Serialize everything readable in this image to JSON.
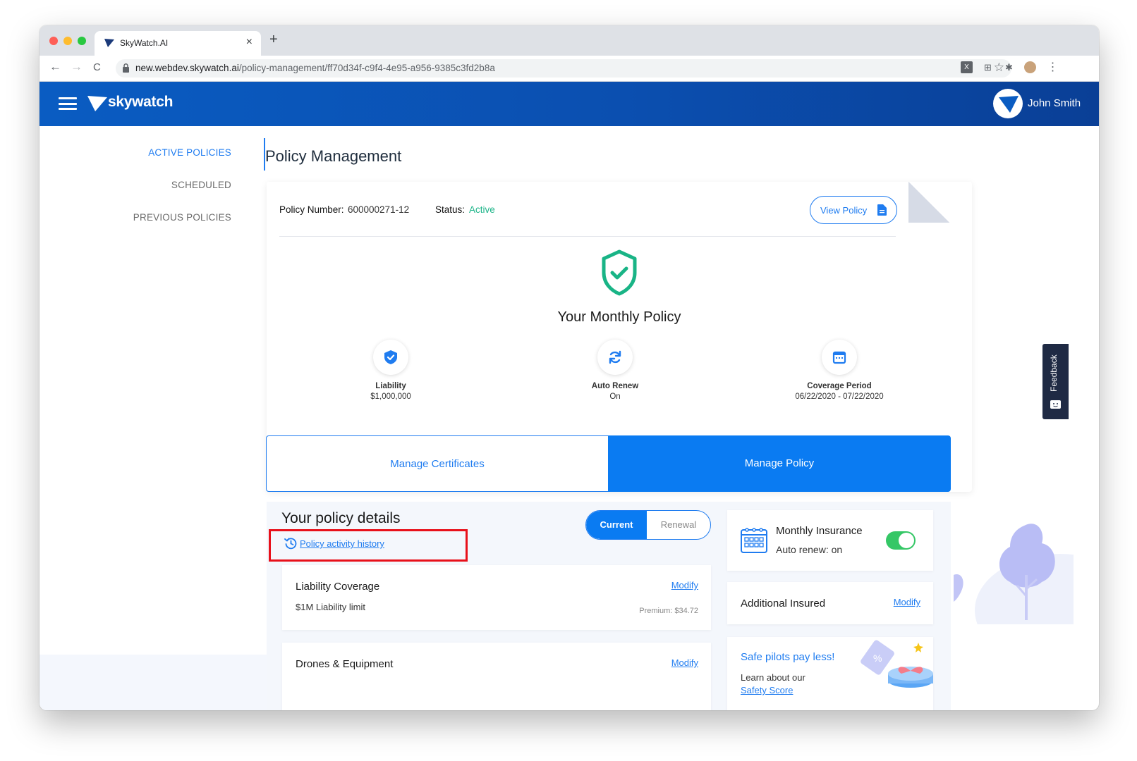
{
  "browser": {
    "tab_title": "SkyWatch.AI",
    "tab_close": "×",
    "new_tab": "+",
    "url_host": "new.webdev.skywatch.ai",
    "url_path": "/policy-management/ff70d34f-c9f4-4e95-a956-9385c3fd2b8a",
    "back": "←",
    "forward": "→",
    "reload": "C",
    "star": "☆",
    "menu": "⋮"
  },
  "app": {
    "logo": "skywatch",
    "user_name": "John Smith",
    "brand_color": "#0a5cc2",
    "accent_color": "#1f7cf0"
  },
  "sidebar": {
    "items": [
      {
        "label": "ACTIVE POLICIES",
        "active": true
      },
      {
        "label": "SCHEDULED",
        "active": false
      },
      {
        "label": "PREVIOUS POLICIES",
        "active": false
      }
    ]
  },
  "main": {
    "title": "Policy Management",
    "policy_number_label": "Policy Number:",
    "policy_number": "600000271-12",
    "status_label": "Status:",
    "status": "Active",
    "view_policy": "View Policy",
    "plan_title": "Your Monthly Policy",
    "features": [
      {
        "icon": "shield-check-icon",
        "label": "Liability",
        "value": "$1,000,000"
      },
      {
        "icon": "refresh-icon",
        "label": "Auto Renew",
        "value": "On"
      },
      {
        "icon": "calendar-icon",
        "label": "Coverage Period",
        "value": "06/22/2020 - 07/22/2020"
      }
    ],
    "manage_certificates": "Manage Certificates",
    "manage_policy": "Manage Policy"
  },
  "details": {
    "title": "Your policy details",
    "history_link": "Policy activity history",
    "toggle": {
      "current": "Current",
      "renewal": "Renewal",
      "selected": "Current"
    },
    "coverages": [
      {
        "title": "Liability Coverage",
        "subtitle": "$1M Liability limit",
        "modify": "Modify",
        "premium": "Premium: $34.72"
      },
      {
        "title": "Drones & Equipment",
        "subtitle": "",
        "modify": "Modify",
        "premium": ""
      }
    ],
    "monthly_insurance": {
      "title": "Monthly Insurance",
      "subtitle": "Auto renew: on",
      "toggle_on": true
    },
    "additional_insured": {
      "title": "Additional Insured",
      "modify": "Modify"
    },
    "promo": {
      "title": "Safe pilots pay less!",
      "subtitle": "Learn about our",
      "link": "Safety Score"
    }
  },
  "feedback": {
    "label": "Feedback"
  }
}
